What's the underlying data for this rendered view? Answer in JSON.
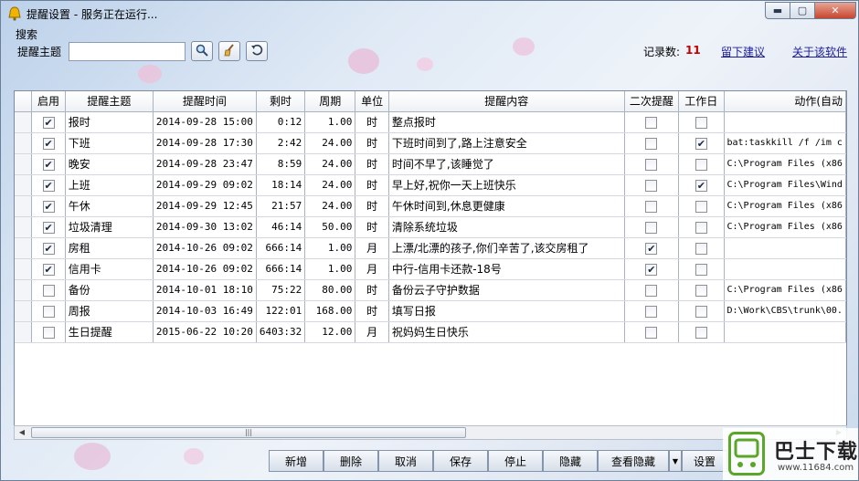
{
  "window": {
    "title": "提醒设置 - 服务正在运行...",
    "controls": {
      "minimize": "▬",
      "maximize": "▢",
      "close": "✕"
    }
  },
  "search": {
    "group_label": "搜索",
    "topic_label": "提醒主题",
    "input_value": "",
    "count_label": "记录数:",
    "count_value": "11",
    "suggest_link": "留下建议",
    "about_link": "关于该软件"
  },
  "table": {
    "columns": [
      "启用",
      "提醒主题",
      "提醒时间",
      "剩时",
      "周期",
      "单位",
      "提醒内容",
      "二次提醒",
      "工作日",
      "动作(自动"
    ],
    "rows": [
      {
        "enabled": true,
        "topic": "报时",
        "time": "2014-09-28 15:00",
        "remain": "0:12",
        "period": "1.00",
        "unit": "时",
        "content": "整点报时",
        "second": false,
        "workday": false,
        "action": ""
      },
      {
        "enabled": true,
        "topic": "下班",
        "time": "2014-09-28 17:30",
        "remain": "2:42",
        "period": "24.00",
        "unit": "时",
        "content": "下班时间到了,路上注意安全",
        "second": false,
        "workday": true,
        "action": "bat:taskkill /f /im c"
      },
      {
        "enabled": true,
        "topic": "晚安",
        "time": "2014-09-28 23:47",
        "remain": "8:59",
        "period": "24.00",
        "unit": "时",
        "content": "时间不早了,该睡觉了",
        "second": false,
        "workday": false,
        "action": "C:\\Program Files (x86"
      },
      {
        "enabled": true,
        "topic": "上班",
        "time": "2014-09-29 09:02",
        "remain": "18:14",
        "period": "24.00",
        "unit": "时",
        "content": "早上好,祝你一天上班快乐",
        "second": false,
        "workday": true,
        "action": "C:\\Program Files\\Wind"
      },
      {
        "enabled": true,
        "topic": "午休",
        "time": "2014-09-29 12:45",
        "remain": "21:57",
        "period": "24.00",
        "unit": "时",
        "content": "午休时间到,休息更健康",
        "second": false,
        "workday": false,
        "action": "C:\\Program Files (x86"
      },
      {
        "enabled": true,
        "topic": "垃圾清理",
        "time": "2014-09-30 13:02",
        "remain": "46:14",
        "period": "50.00",
        "unit": "时",
        "content": "清除系统垃圾",
        "second": false,
        "workday": false,
        "action": "C:\\Program Files (x86"
      },
      {
        "enabled": true,
        "topic": "房租",
        "time": "2014-10-26 09:02",
        "remain": "666:14",
        "period": "1.00",
        "unit": "月",
        "content": "上漂/北漂的孩子,你们辛苦了,该交房租了",
        "second": true,
        "workday": false,
        "action": ""
      },
      {
        "enabled": true,
        "topic": "信用卡",
        "time": "2014-10-26 09:02",
        "remain": "666:14",
        "period": "1.00",
        "unit": "月",
        "content": "中行-信用卡还款-18号",
        "second": true,
        "workday": false,
        "action": ""
      },
      {
        "enabled": false,
        "topic": "备份",
        "time": "2014-10-01 18:10",
        "remain": "75:22",
        "period": "80.00",
        "unit": "时",
        "content": "备份云子守护数据",
        "second": false,
        "workday": false,
        "action": "C:\\Program Files (x86"
      },
      {
        "enabled": false,
        "topic": "周报",
        "time": "2014-10-03 16:49",
        "remain": "122:01",
        "period": "168.00",
        "unit": "时",
        "content": "填写日报",
        "second": false,
        "workday": false,
        "action": "D:\\Work\\CBS\\trunk\\00."
      },
      {
        "enabled": false,
        "topic": "生日提醒",
        "time": "2015-06-22 10:20",
        "remain": "6403:32",
        "period": "12.00",
        "unit": "月",
        "content": "祝妈妈生日快乐",
        "second": false,
        "workday": false,
        "action": ""
      }
    ]
  },
  "buttons": {
    "add": "新增",
    "delete": "删除",
    "cancel": "取消",
    "save": "保存",
    "stop": "停止",
    "hide": "隐藏",
    "view_hidden": "查看隐藏",
    "settings": "设置"
  },
  "watermark": {
    "text": "巴士下载",
    "url": "www.11684.com"
  },
  "colors": {
    "count": "#c00000",
    "link": "#1c1c9c",
    "logo_green": "#5aa628"
  }
}
